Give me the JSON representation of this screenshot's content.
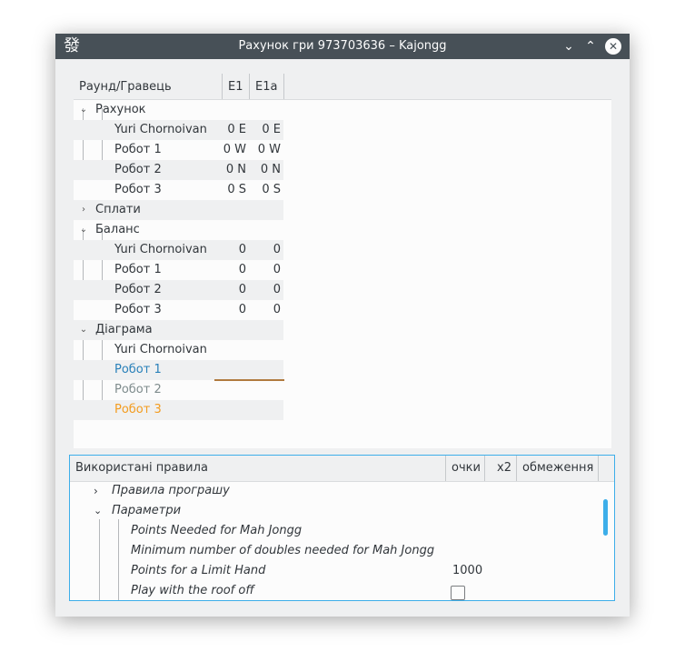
{
  "window": {
    "title": "Рахунок гри 973703636 – Kajongg",
    "app_icon": "發",
    "buttons": {
      "minimize": "⌄",
      "maximize": "⌃",
      "close": "✕"
    }
  },
  "score_table": {
    "headers": [
      "Раунд/Гравець",
      "E1",
      "E1a"
    ],
    "sections": [
      {
        "label": "Рахунок",
        "expanded": true,
        "rows": [
          {
            "name": "Yuri Chornoivan",
            "v1": "0 E",
            "v2": "0 E"
          },
          {
            "name": "Робот 1",
            "v1": "0 W",
            "v2": "0 W"
          },
          {
            "name": "Робот 2",
            "v1": "0 N",
            "v2": "0 N"
          },
          {
            "name": "Робот 3",
            "v1": "0 S",
            "v2": "0 S"
          }
        ]
      },
      {
        "label": "Сплати",
        "expanded": false,
        "rows": []
      },
      {
        "label": "Баланс",
        "expanded": true,
        "rows": [
          {
            "name": "Yuri Chornoivan",
            "v1": "0",
            "v2": "0"
          },
          {
            "name": "Робот 1",
            "v1": "0",
            "v2": "0"
          },
          {
            "name": "Робот 2",
            "v1": "0",
            "v2": "0"
          },
          {
            "name": "Робот 3",
            "v1": "0",
            "v2": "0"
          }
        ]
      },
      {
        "label": "Діаграма",
        "expanded": true,
        "rows": [
          {
            "name": "Yuri Chornoivan",
            "color": "#31363b"
          },
          {
            "name": "Робот 1",
            "color": "#2980b9"
          },
          {
            "name": "Робот 2",
            "color": "#7f8c8d"
          },
          {
            "name": "Робот 3",
            "color": "#f39c1f"
          }
        ]
      }
    ]
  },
  "rules_table": {
    "headers": [
      "Використані правила",
      "очки",
      "x2",
      "обмеження"
    ],
    "rows": [
      {
        "label": "Правила програшу",
        "expander": "›"
      },
      {
        "label": "Параметри",
        "expander": "⌄"
      },
      {
        "label": "Points Needed for Mah Jongg",
        "value": ""
      },
      {
        "label": "Minimum number of doubles needed for Mah Jongg",
        "value": ""
      },
      {
        "label": "Points for a Limit Hand",
        "value": "1000"
      },
      {
        "label": "Play with the roof off",
        "checked": false
      }
    ]
  },
  "colors": {
    "accent": "#3daee9",
    "titlebar": "#475057"
  }
}
